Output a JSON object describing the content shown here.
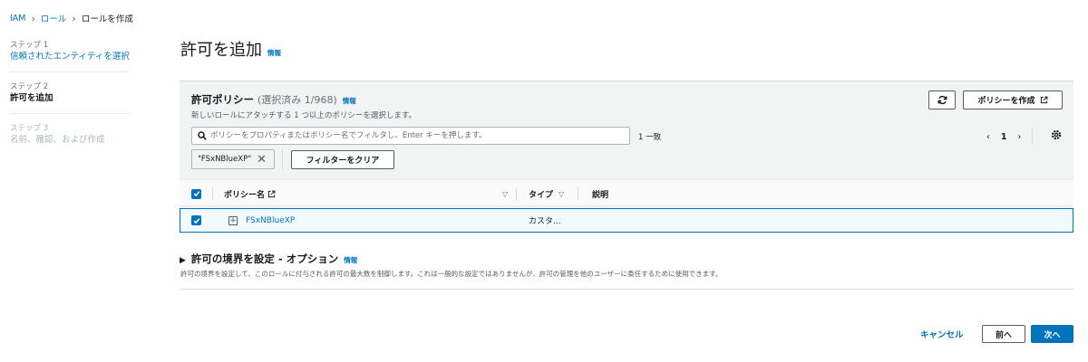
{
  "breadcrumb": [
    {
      "label": "IAM"
    },
    {
      "label": "ロール"
    },
    {
      "label": "ロールを作成"
    }
  ],
  "steps": [
    {
      "num": "ステップ 1",
      "title": "信頼されたエンティティを選択",
      "state": "done"
    },
    {
      "num": "ステップ 2",
      "title": "許可を追加",
      "state": "active"
    },
    {
      "num": "ステップ 3",
      "title": "名前、確認、および作成",
      "state": "future"
    }
  ],
  "page": {
    "title": "許可を追加",
    "info": "情報"
  },
  "policies": {
    "title": "許可ポリシー",
    "selected_count": "(選択済み 1/968)",
    "info": "情報",
    "description": "新しいロールにアタッチする 1 つ以上のポリシーを選択します。",
    "refresh_icon": "refresh-icon",
    "create_button": "ポリシーを作成",
    "search_placeholder": "ポリシーをプロパティまたはポリシー名でフィルタし、Enter キーを押します。",
    "search_value": "",
    "match_count": "1 一致",
    "page_number": "1",
    "filter_token": "\"FSxNBlueXP\"",
    "clear_filters_button": "フィルターをクリア",
    "columns": [
      "ポリシー名",
      "タイプ",
      "説明"
    ],
    "rows": [
      {
        "checked": true,
        "name": "FSxNBlueXP",
        "type": "カスタ...",
        "description": ""
      }
    ]
  },
  "boundary": {
    "title": "許可の境界を設定 - オプション",
    "info": "情報",
    "description": "許可の境界を設定して、このロールに付与される許可の最大数を制御します。これは一般的な設定ではありませんが、許可の管理を他のユーザーに委任するために使用できます。"
  },
  "footer": {
    "cancel": "キャンセル",
    "previous": "前へ",
    "next": "次へ"
  },
  "colors": {
    "link": "#0073bb",
    "primary": "#0073bb",
    "panel_bg": "#f2f3f3",
    "selected_row_bg": "#f1faff"
  }
}
